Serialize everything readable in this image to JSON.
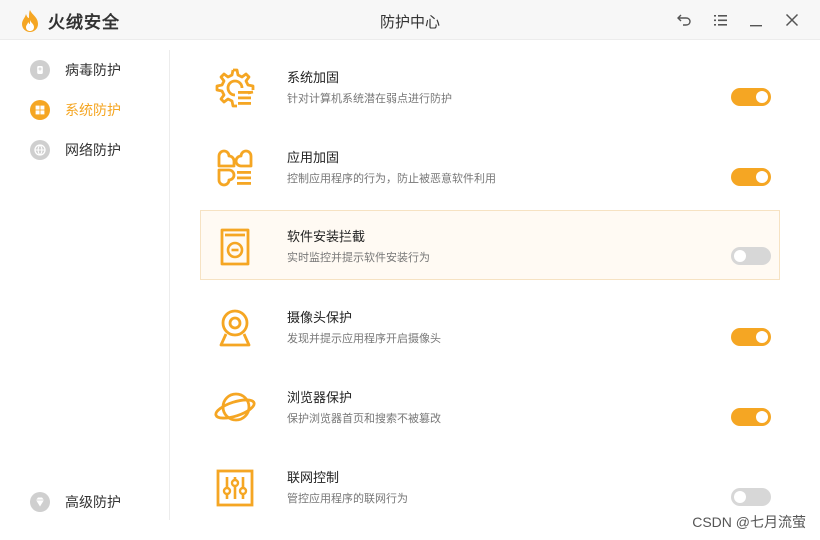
{
  "app": {
    "brand_name": "火绒安全",
    "window_title": "防护中心",
    "accent_color": "#f5a623",
    "window_controls": [
      {
        "name": "back-icon"
      },
      {
        "name": "menu-icon"
      },
      {
        "name": "minimize-icon"
      },
      {
        "name": "close-icon"
      }
    ]
  },
  "sidebar": {
    "items": [
      {
        "label": "病毒防护",
        "icon": "virus-shield-icon",
        "active": false
      },
      {
        "label": "系统防护",
        "icon": "windows-icon",
        "active": true
      },
      {
        "label": "网络防护",
        "icon": "globe-icon",
        "active": false
      }
    ],
    "bottom_item": {
      "label": "高级防护",
      "icon": "diamond-icon"
    }
  },
  "features": [
    {
      "title": "系统加固",
      "desc": "针对计算机系统潜在弱点进行防护",
      "icon": "gear-list-icon",
      "enabled": true
    },
    {
      "title": "应用加固",
      "desc": "控制应用程序的行为，防止被恶意软件利用",
      "icon": "app-grid-icon",
      "enabled": true
    },
    {
      "title": "软件安装拦截",
      "desc": "实时监控并提示软件安装行为",
      "icon": "install-block-icon",
      "enabled": false
    },
    {
      "title": "摄像头保护",
      "desc": "发现并提示应用程序开启摄像头",
      "icon": "webcam-icon",
      "enabled": true
    },
    {
      "title": "浏览器保护",
      "desc": "保护浏览器首页和搜索不被篡改",
      "icon": "planet-icon",
      "enabled": true
    },
    {
      "title": "联网控制",
      "desc": "管控应用程序的联网行为",
      "icon": "network-sliders-icon",
      "enabled": false
    }
  ],
  "watermark": "CSDN @七月流萤"
}
